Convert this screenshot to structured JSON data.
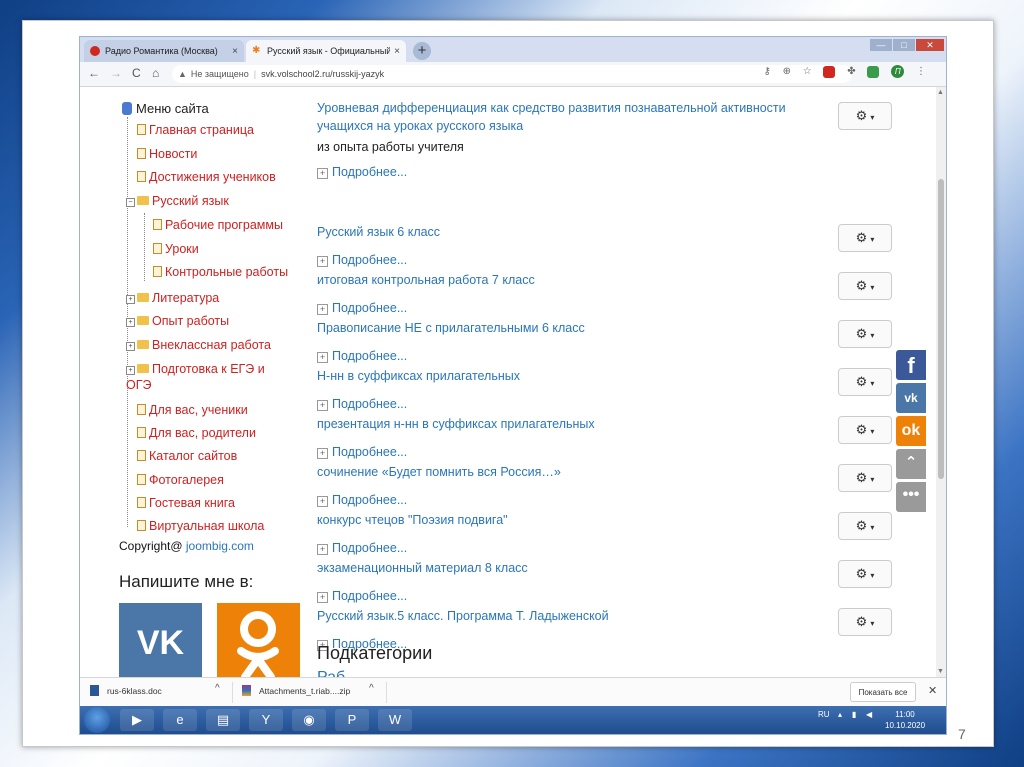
{
  "browser": {
    "tabs": [
      {
        "title": "Радио Романтика (Москва)",
        "close": "×"
      },
      {
        "title": "Русский язык - Официальный с",
        "close": "×"
      }
    ],
    "new_tab": "+",
    "window_controls": {
      "minimize": "—",
      "maximize": "□",
      "close": "✕"
    },
    "nav": {
      "back": "←",
      "forward": "→",
      "reload": "C",
      "home": "⌂"
    },
    "address": {
      "security_label": "Не защищено",
      "url": "svk.volschool2.ru/russkij-yazyk"
    }
  },
  "sidebar": {
    "menu_title": "Меню сайта",
    "items": [
      {
        "label": "Главная страница"
      },
      {
        "label": "Новости"
      },
      {
        "label": "Достижения учеников"
      },
      {
        "label": "Русский язык"
      },
      {
        "label": "Рабочие программы"
      },
      {
        "label": "Уроки"
      },
      {
        "label": "Контрольные работы"
      },
      {
        "label": "Литература"
      },
      {
        "label": "Опыт работы"
      },
      {
        "label": "Внеклассная работа"
      },
      {
        "label": "Подготовка к ЕГЭ и ОГЭ"
      },
      {
        "label": "Для вас, ученики"
      },
      {
        "label": "Для вас, родители"
      },
      {
        "label": "Каталог сайтов"
      },
      {
        "label": "Фотогалерея"
      },
      {
        "label": "Гостевая книга"
      },
      {
        "label": "Виртуальная школа"
      }
    ],
    "copyright_prefix": "Copyright@",
    "copyright_link": "joombig.com",
    "write_me": "Напишите мне в:"
  },
  "articles": [
    {
      "title": "Уровневая дифференциация как средство развития познавательной активности учащихся на уроках русского языка",
      "description": "из опыта работы учителя",
      "readmore": "Подробнее..."
    },
    {
      "title": "Русский язык 6 класс",
      "readmore": "Подробнее..."
    },
    {
      "title": "итоговая контрольная работа 7 класс",
      "readmore": "Подробнее..."
    },
    {
      "title": "Правописание НЕ с прилагательными 6 класс",
      "readmore": "Подробнее..."
    },
    {
      "title": "Н-нн в суффиксах прилагательных",
      "readmore": "Подробнее..."
    },
    {
      "title": "презентация н-нн в суффиксах прилагательных",
      "readmore": "Подробнее..."
    },
    {
      "title": "сочинение «Будет помнить вся Россия…»",
      "readmore": "Подробнее..."
    },
    {
      "title": "конкурс чтецов \"Поэзия подвига\"",
      "readmore": "Подробнее..."
    },
    {
      "title": "экзаменационный материал 8 класс",
      "readmore": "Подробнее..."
    },
    {
      "title": "Русский язык.5 класс. Программа Т. Ладыженской",
      "readmore": "Подробнее..."
    }
  ],
  "gear": {
    "icon": "⚙",
    "caret": "▾"
  },
  "subcategories": {
    "heading": "Подкатегории",
    "first_link": "Раб"
  },
  "social_bar": {
    "facebook": "f",
    "vk": "vk",
    "ok": "ok",
    "up": "⌃",
    "more": "•••"
  },
  "downloads": {
    "items": [
      {
        "name": "rus-6klass.doc",
        "caret": "^"
      },
      {
        "name": "Attachments_t.riab....zip",
        "caret": "^"
      }
    ],
    "show_all": "Показать все",
    "close": "✕"
  },
  "taskbar": {
    "lang": "RU",
    "time": "11:00",
    "date": "10.10.2020"
  },
  "slide": {
    "number": "7"
  },
  "colors": {
    "link": "#2a76b8",
    "menu_item": "#cc2222",
    "vk": "#4a76a8",
    "ok": "#ee8208",
    "facebook": "#3b5998"
  }
}
